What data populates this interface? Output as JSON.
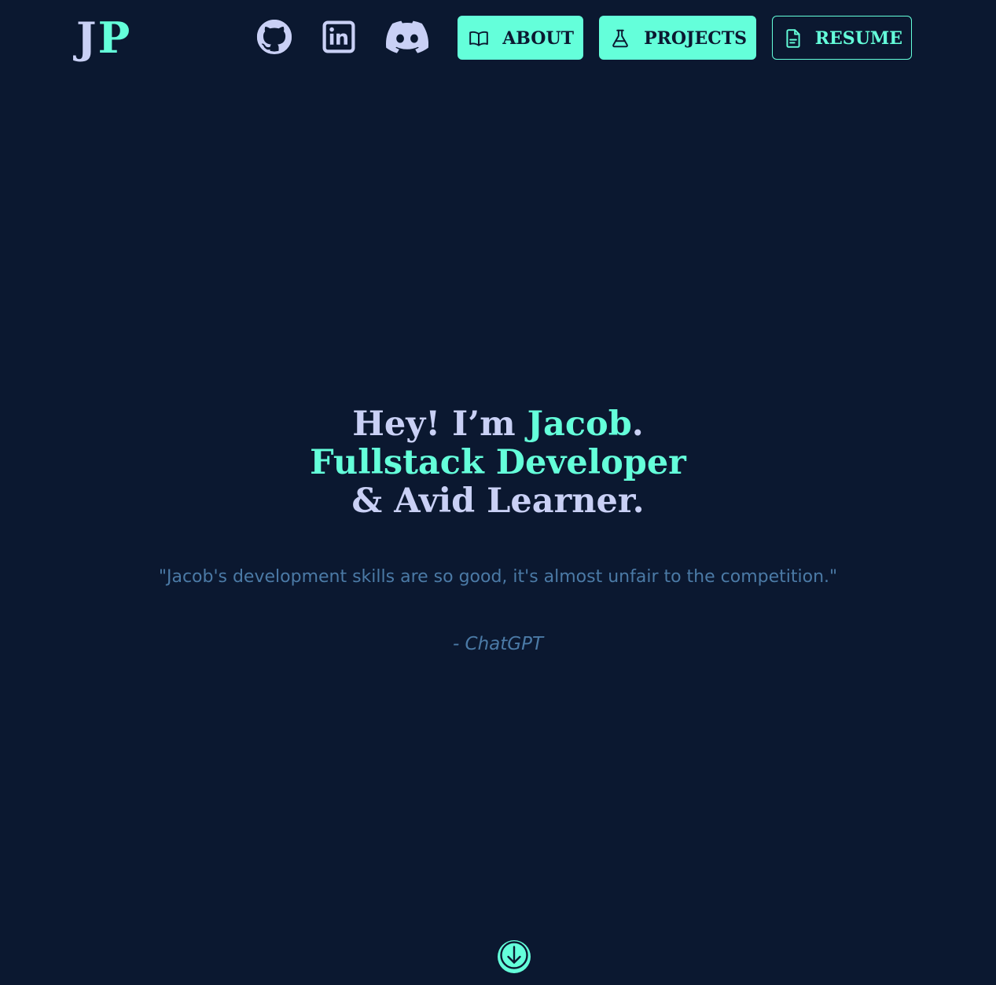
{
  "logo": {
    "first": "J",
    "second": "P"
  },
  "social": [
    {
      "icon": "github-icon",
      "label": "GitHub"
    },
    {
      "icon": "linkedin-icon",
      "label": "LinkedIn"
    },
    {
      "icon": "discord-icon",
      "label": "Discord"
    }
  ],
  "nav": {
    "about_label": "ABOUT",
    "projects_label": "PROJECTS",
    "resume_label": "RESUME",
    "about_icon": "book-open-icon",
    "projects_icon": "flask-icon",
    "resume_icon": "document-icon"
  },
  "hero": {
    "line1_prefix": "Hey! I’m ",
    "line1_name": "Jacob",
    "line1_suffix": ".",
    "line2": "Fullstack Developer",
    "line3": "& Avid Learner."
  },
  "quote": {
    "text": "\"Jacob's development skills are so good, it's almost unfair to the competition.\"",
    "attribution": "- ChatGPT"
  },
  "scroll": {
    "icon": "arrow-down-circle-icon"
  },
  "colors": {
    "background": "#0b1830",
    "accent": "#64ffda",
    "light_text": "#c9d0f5",
    "muted_text": "#4b7aa6"
  }
}
